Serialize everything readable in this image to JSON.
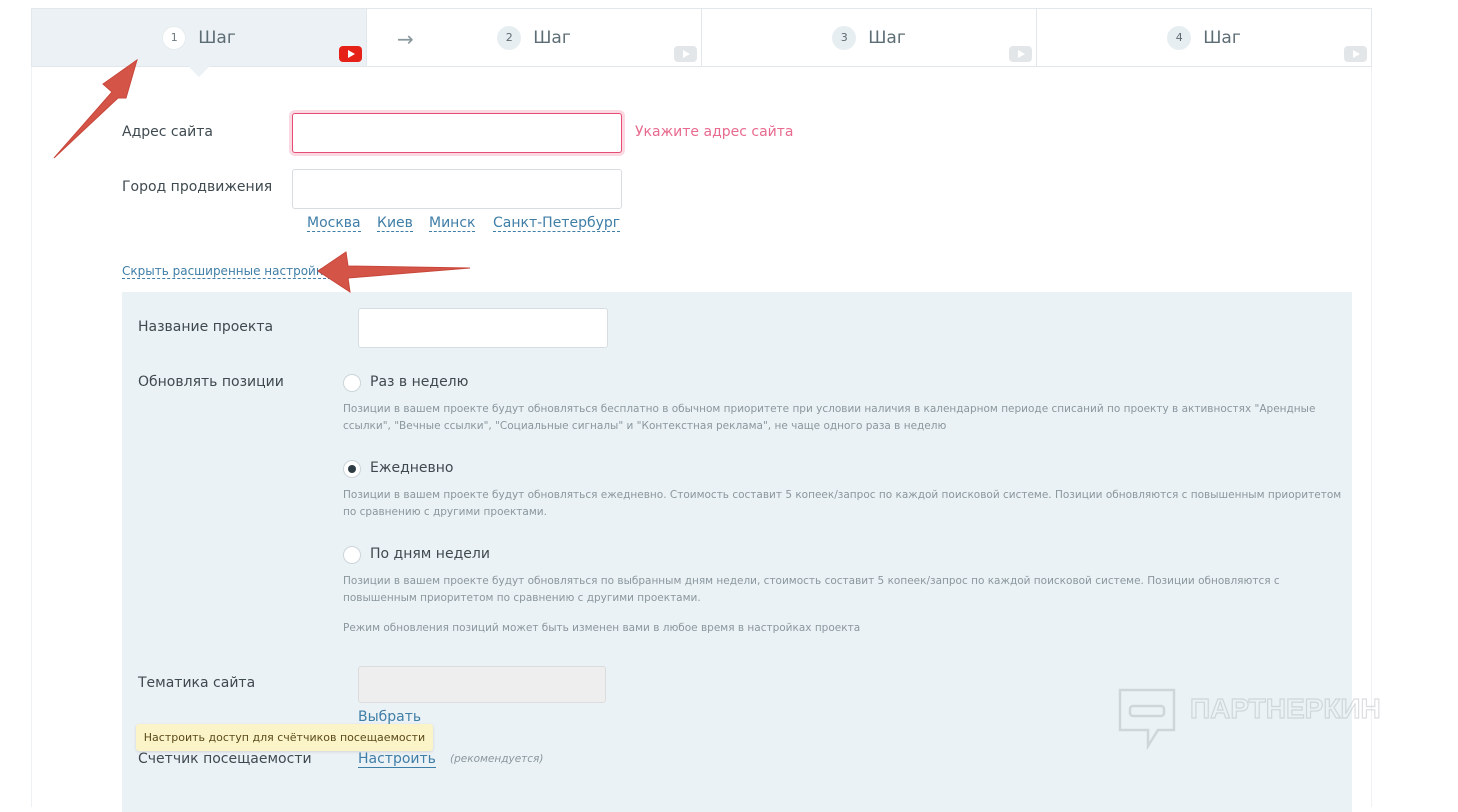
{
  "steps": [
    {
      "num": "1",
      "label": "Шаг",
      "active": true
    },
    {
      "num": "2",
      "label": "Шаг",
      "active": false
    },
    {
      "num": "3",
      "label": "Шаг",
      "active": false
    },
    {
      "num": "4",
      "label": "Шаг",
      "active": false
    }
  ],
  "form": {
    "site_address_label": "Адрес сайта",
    "site_address_value": "",
    "site_address_error": "Укажите адрес сайта",
    "city_label": "Город продвижения",
    "city_value": "",
    "city_suggestions": [
      "Москва",
      "Киев",
      "Минск",
      "Санкт-Петербург"
    ],
    "toggle_advanced": "Скрыть расширенные настройки"
  },
  "advanced": {
    "project_name_label": "Название проекта",
    "project_name_value": "",
    "update_label": "Обновлять позиции",
    "options": [
      {
        "label": "Раз в неделю",
        "selected": false,
        "desc": "Позиции в вашем проекте будут обновляться бесплатно в обычном приоритете при условии наличия в календарном периоде списаний по проекту в активностях \"Арендные ссылки\", \"Вечные ссылки\", \"Социальные сигналы\" и \"Контекстная реклама\", не чаще одного раза в неделю"
      },
      {
        "label": "Ежедневно",
        "selected": true,
        "desc": "Позиции в вашем проекте будут обновляться ежедневно. Стоимость составит 5 копеек/запрос по каждой поисковой системе. Позиции обновляются с повышенным приоритетом по сравнению с другими проектами."
      },
      {
        "label": "По дням недели",
        "selected": false,
        "desc": "Позиции в вашем проекте будут обновляться по выбранным дням недели, стоимость составит 5 копеек/запрос по каждой поисковой системе. Позиции обновляются с повышенным приоритетом по сравнению с другими проектами."
      }
    ],
    "mode_note": "Режим обновления позиций может быть изменен вами в любое время в настройках проекта",
    "theme_label": "Тематика сайта",
    "theme_value": "",
    "choose_link": "Выбрать",
    "counter_label": "Счетчик посещаемости",
    "configure_link": "Настроить",
    "recommended": "(рекомендуется)"
  },
  "tooltip": "Настроить доступ для счётчиков посещаемости",
  "watermark": "ПАРТНЕРКИН",
  "colors": {
    "accent_link": "#3f7ea7",
    "error": "#e86a8e",
    "panel_bg": "#ebf2f5",
    "annotation_arrow": "#d9534f"
  }
}
